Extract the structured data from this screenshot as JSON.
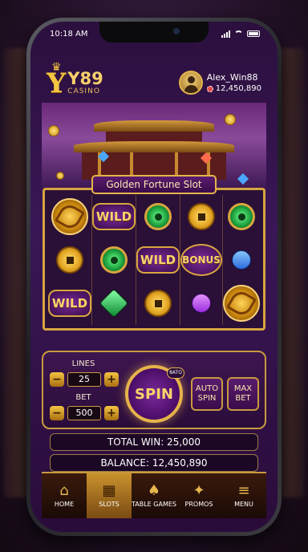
{
  "status_bar": {
    "time": "10:18 AM"
  },
  "brand": {
    "logo_letter": "Y",
    "name": "Y89",
    "tagline": "CASINO"
  },
  "user": {
    "username": "Alex_Win88",
    "balance": "12,450,890"
  },
  "game": {
    "title": "Golden Fortune Slot"
  },
  "reels": [
    [
      "dragon",
      "wild",
      "jade",
      "coin",
      "jade"
    ],
    [
      "coin",
      "jade",
      "wild",
      "bonus",
      "sapphire"
    ],
    [
      "wild",
      "emerald",
      "coin",
      "amethyst",
      "dragon"
    ]
  ],
  "symbol_labels": {
    "wild": "WILD",
    "bonus": "BONUS"
  },
  "controls": {
    "lines_label": "LINES",
    "lines_value": "25",
    "bet_label": "BET",
    "bet_value": "500",
    "minus": "−",
    "plus": "+",
    "spin_label": "SPIN",
    "spin_badge": "8ATO",
    "auto_spin": "AUTO SPIN",
    "max_bet": "MAX BET"
  },
  "totals": {
    "total_win": "TOTAL WIN: 25,000",
    "balance": "BALANCE: 12,450,890"
  },
  "nav": [
    {
      "label": "HOME",
      "icon": "⌂"
    },
    {
      "label": "SLOTS",
      "icon": "▦"
    },
    {
      "label": "TABLE GAMES",
      "icon": "♠"
    },
    {
      "label": "PROMOS",
      "icon": "✦"
    },
    {
      "label": "MENU",
      "icon": "≡"
    }
  ],
  "colors": {
    "gold": "#e5b34a",
    "purple": "#3a1656"
  }
}
